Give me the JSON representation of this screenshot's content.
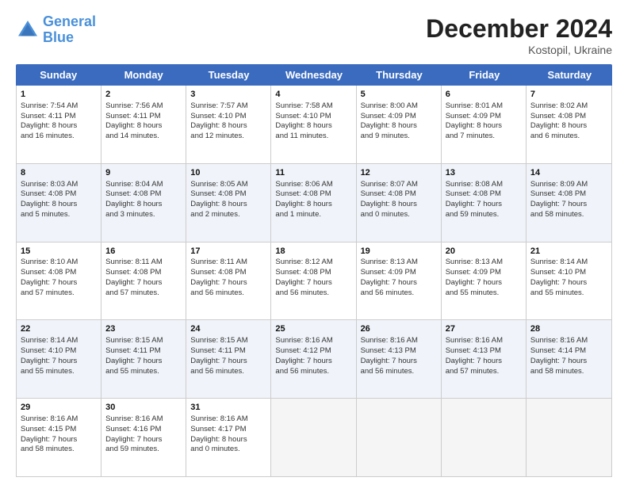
{
  "header": {
    "logo_line1": "General",
    "logo_line2": "Blue",
    "month": "December 2024",
    "location": "Kostopil, Ukraine"
  },
  "days_of_week": [
    "Sunday",
    "Monday",
    "Tuesday",
    "Wednesday",
    "Thursday",
    "Friday",
    "Saturday"
  ],
  "rows": [
    [
      {
        "day": "1",
        "lines": [
          "Sunrise: 7:54 AM",
          "Sunset: 4:11 PM",
          "Daylight: 8 hours",
          "and 16 minutes."
        ]
      },
      {
        "day": "2",
        "lines": [
          "Sunrise: 7:56 AM",
          "Sunset: 4:11 PM",
          "Daylight: 8 hours",
          "and 14 minutes."
        ]
      },
      {
        "day": "3",
        "lines": [
          "Sunrise: 7:57 AM",
          "Sunset: 4:10 PM",
          "Daylight: 8 hours",
          "and 12 minutes."
        ]
      },
      {
        "day": "4",
        "lines": [
          "Sunrise: 7:58 AM",
          "Sunset: 4:10 PM",
          "Daylight: 8 hours",
          "and 11 minutes."
        ]
      },
      {
        "day": "5",
        "lines": [
          "Sunrise: 8:00 AM",
          "Sunset: 4:09 PM",
          "Daylight: 8 hours",
          "and 9 minutes."
        ]
      },
      {
        "day": "6",
        "lines": [
          "Sunrise: 8:01 AM",
          "Sunset: 4:09 PM",
          "Daylight: 8 hours",
          "and 7 minutes."
        ]
      },
      {
        "day": "7",
        "lines": [
          "Sunrise: 8:02 AM",
          "Sunset: 4:08 PM",
          "Daylight: 8 hours",
          "and 6 minutes."
        ]
      }
    ],
    [
      {
        "day": "8",
        "lines": [
          "Sunrise: 8:03 AM",
          "Sunset: 4:08 PM",
          "Daylight: 8 hours",
          "and 5 minutes."
        ]
      },
      {
        "day": "9",
        "lines": [
          "Sunrise: 8:04 AM",
          "Sunset: 4:08 PM",
          "Daylight: 8 hours",
          "and 3 minutes."
        ]
      },
      {
        "day": "10",
        "lines": [
          "Sunrise: 8:05 AM",
          "Sunset: 4:08 PM",
          "Daylight: 8 hours",
          "and 2 minutes."
        ]
      },
      {
        "day": "11",
        "lines": [
          "Sunrise: 8:06 AM",
          "Sunset: 4:08 PM",
          "Daylight: 8 hours",
          "and 1 minute."
        ]
      },
      {
        "day": "12",
        "lines": [
          "Sunrise: 8:07 AM",
          "Sunset: 4:08 PM",
          "Daylight: 8 hours",
          "and 0 minutes."
        ]
      },
      {
        "day": "13",
        "lines": [
          "Sunrise: 8:08 AM",
          "Sunset: 4:08 PM",
          "Daylight: 7 hours",
          "and 59 minutes."
        ]
      },
      {
        "day": "14",
        "lines": [
          "Sunrise: 8:09 AM",
          "Sunset: 4:08 PM",
          "Daylight: 7 hours",
          "and 58 minutes."
        ]
      }
    ],
    [
      {
        "day": "15",
        "lines": [
          "Sunrise: 8:10 AM",
          "Sunset: 4:08 PM",
          "Daylight: 7 hours",
          "and 57 minutes."
        ]
      },
      {
        "day": "16",
        "lines": [
          "Sunrise: 8:11 AM",
          "Sunset: 4:08 PM",
          "Daylight: 7 hours",
          "and 57 minutes."
        ]
      },
      {
        "day": "17",
        "lines": [
          "Sunrise: 8:11 AM",
          "Sunset: 4:08 PM",
          "Daylight: 7 hours",
          "and 56 minutes."
        ]
      },
      {
        "day": "18",
        "lines": [
          "Sunrise: 8:12 AM",
          "Sunset: 4:08 PM",
          "Daylight: 7 hours",
          "and 56 minutes."
        ]
      },
      {
        "day": "19",
        "lines": [
          "Sunrise: 8:13 AM",
          "Sunset: 4:09 PM",
          "Daylight: 7 hours",
          "and 56 minutes."
        ]
      },
      {
        "day": "20",
        "lines": [
          "Sunrise: 8:13 AM",
          "Sunset: 4:09 PM",
          "Daylight: 7 hours",
          "and 55 minutes."
        ]
      },
      {
        "day": "21",
        "lines": [
          "Sunrise: 8:14 AM",
          "Sunset: 4:10 PM",
          "Daylight: 7 hours",
          "and 55 minutes."
        ]
      }
    ],
    [
      {
        "day": "22",
        "lines": [
          "Sunrise: 8:14 AM",
          "Sunset: 4:10 PM",
          "Daylight: 7 hours",
          "and 55 minutes."
        ]
      },
      {
        "day": "23",
        "lines": [
          "Sunrise: 8:15 AM",
          "Sunset: 4:11 PM",
          "Daylight: 7 hours",
          "and 55 minutes."
        ]
      },
      {
        "day": "24",
        "lines": [
          "Sunrise: 8:15 AM",
          "Sunset: 4:11 PM",
          "Daylight: 7 hours",
          "and 56 minutes."
        ]
      },
      {
        "day": "25",
        "lines": [
          "Sunrise: 8:16 AM",
          "Sunset: 4:12 PM",
          "Daylight: 7 hours",
          "and 56 minutes."
        ]
      },
      {
        "day": "26",
        "lines": [
          "Sunrise: 8:16 AM",
          "Sunset: 4:13 PM",
          "Daylight: 7 hours",
          "and 56 minutes."
        ]
      },
      {
        "day": "27",
        "lines": [
          "Sunrise: 8:16 AM",
          "Sunset: 4:13 PM",
          "Daylight: 7 hours",
          "and 57 minutes."
        ]
      },
      {
        "day": "28",
        "lines": [
          "Sunrise: 8:16 AM",
          "Sunset: 4:14 PM",
          "Daylight: 7 hours",
          "and 58 minutes."
        ]
      }
    ],
    [
      {
        "day": "29",
        "lines": [
          "Sunrise: 8:16 AM",
          "Sunset: 4:15 PM",
          "Daylight: 7 hours",
          "and 58 minutes."
        ]
      },
      {
        "day": "30",
        "lines": [
          "Sunrise: 8:16 AM",
          "Sunset: 4:16 PM",
          "Daylight: 7 hours",
          "and 59 minutes."
        ]
      },
      {
        "day": "31",
        "lines": [
          "Sunrise: 8:16 AM",
          "Sunset: 4:17 PM",
          "Daylight: 8 hours",
          "and 0 minutes."
        ]
      },
      {
        "day": "",
        "lines": []
      },
      {
        "day": "",
        "lines": []
      },
      {
        "day": "",
        "lines": []
      },
      {
        "day": "",
        "lines": []
      }
    ]
  ]
}
